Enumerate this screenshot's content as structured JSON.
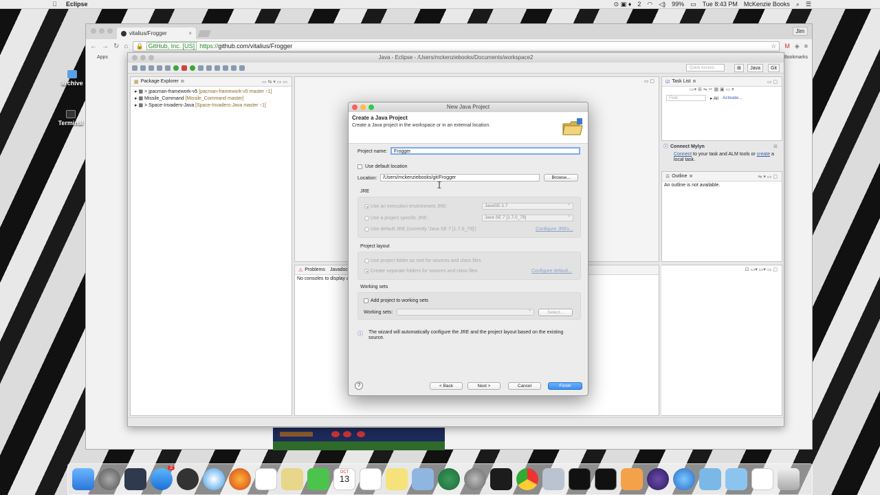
{
  "menubar": {
    "app_name": "Eclipse",
    "notifications": "2",
    "battery": "99%",
    "clock": "Tue 8:43 PM",
    "user": "McKenzie Books"
  },
  "desktop": {
    "icons": [
      {
        "label": "archive"
      },
      {
        "label": "Terminal"
      }
    ]
  },
  "chrome": {
    "tab_title": "vitalius/Frogger",
    "user_label": "Jim",
    "ev_cert": "GitHub, Inc. [US]",
    "url_scheme": "https://",
    "url_rest": "github.com/vitalius/Frogger",
    "bookmarks": [
      "Apps",
      "Bookmarks"
    ]
  },
  "eclipse": {
    "window_title": "Java - Eclipse - /Users/mckenziebooks/Documents/workspace2",
    "quick_access": "Quick Access",
    "perspectives": [
      "Java",
      "Git"
    ],
    "package_explorer": {
      "title": "Package Explorer",
      "items": [
        {
          "name": "> jpacman-framework-v5",
          "deco": "[pacman-framework-v5 master ↑1]"
        },
        {
          "name": "Missile_Command",
          "deco": "[Missile_Command master]"
        },
        {
          "name": "> Space-Invaders-Java",
          "deco": "[Space-Invaders-Java master ↑1]"
        }
      ]
    },
    "task_list": {
      "title": "Task List",
      "find_placeholder": "Find",
      "all_label": "All",
      "activate_label": "Activate..."
    },
    "mylyn": {
      "title": "Connect Mylyn",
      "connect": "Connect",
      "text1": " to your task and ALM tools or ",
      "create": "create",
      "text2": " a local task."
    },
    "outline": {
      "title": "Outline",
      "message": "An outline is not available."
    },
    "console": {
      "tab1": "Problems",
      "tab2": "Javadoc",
      "message": "No consoles to display at this time."
    }
  },
  "dialog": {
    "window_title": "New Java Project",
    "header_title": "Create a Java Project",
    "header_desc": "Create a Java project in the workspace or in an external location.",
    "project_name_label": "Project name:",
    "project_name_value": "Frogger",
    "use_default_location": "Use default location",
    "location_label": "Location:",
    "location_value": "/Users/mckenziebooks/git/Frogger",
    "browse": "Browse...",
    "jre_section": "JRE",
    "jre_opt1": "Use an execution environment JRE:",
    "jre_opt1_value": "JavaSE-1.7",
    "jre_opt2": "Use a project specific JRE:",
    "jre_opt2_value": "Java SE 7 [1.7.0_79]",
    "jre_opt3": "Use default JRE (currently 'Java SE 7 [1.7.0_79]')",
    "configure_jres": "Configure JREs...",
    "layout_section": "Project layout",
    "layout_opt1": "Use project folder as root for sources and class files",
    "layout_opt2": "Create separate folders for sources and class files",
    "configure_default": "Configure default...",
    "ws_section": "Working sets",
    "add_to_ws": "Add project to working sets",
    "ws_label": "Working sets:",
    "select": "Select...",
    "info": "The wizard will automatically configure the JRE and the project layout based on the existing source.",
    "help": "?",
    "back": "< Back",
    "next": "Next >",
    "cancel": "Cancel",
    "finish": "Finish"
  },
  "dock": {
    "calendar_month": "OCT",
    "calendar_day": "13",
    "appstore_badge": "2"
  },
  "colors": {
    "accent": "#3b8ff0",
    "link": "#3a60a8",
    "close_red": "#fc605c",
    "min_yellow": "#fdbc40",
    "max_green": "#34c84a"
  }
}
